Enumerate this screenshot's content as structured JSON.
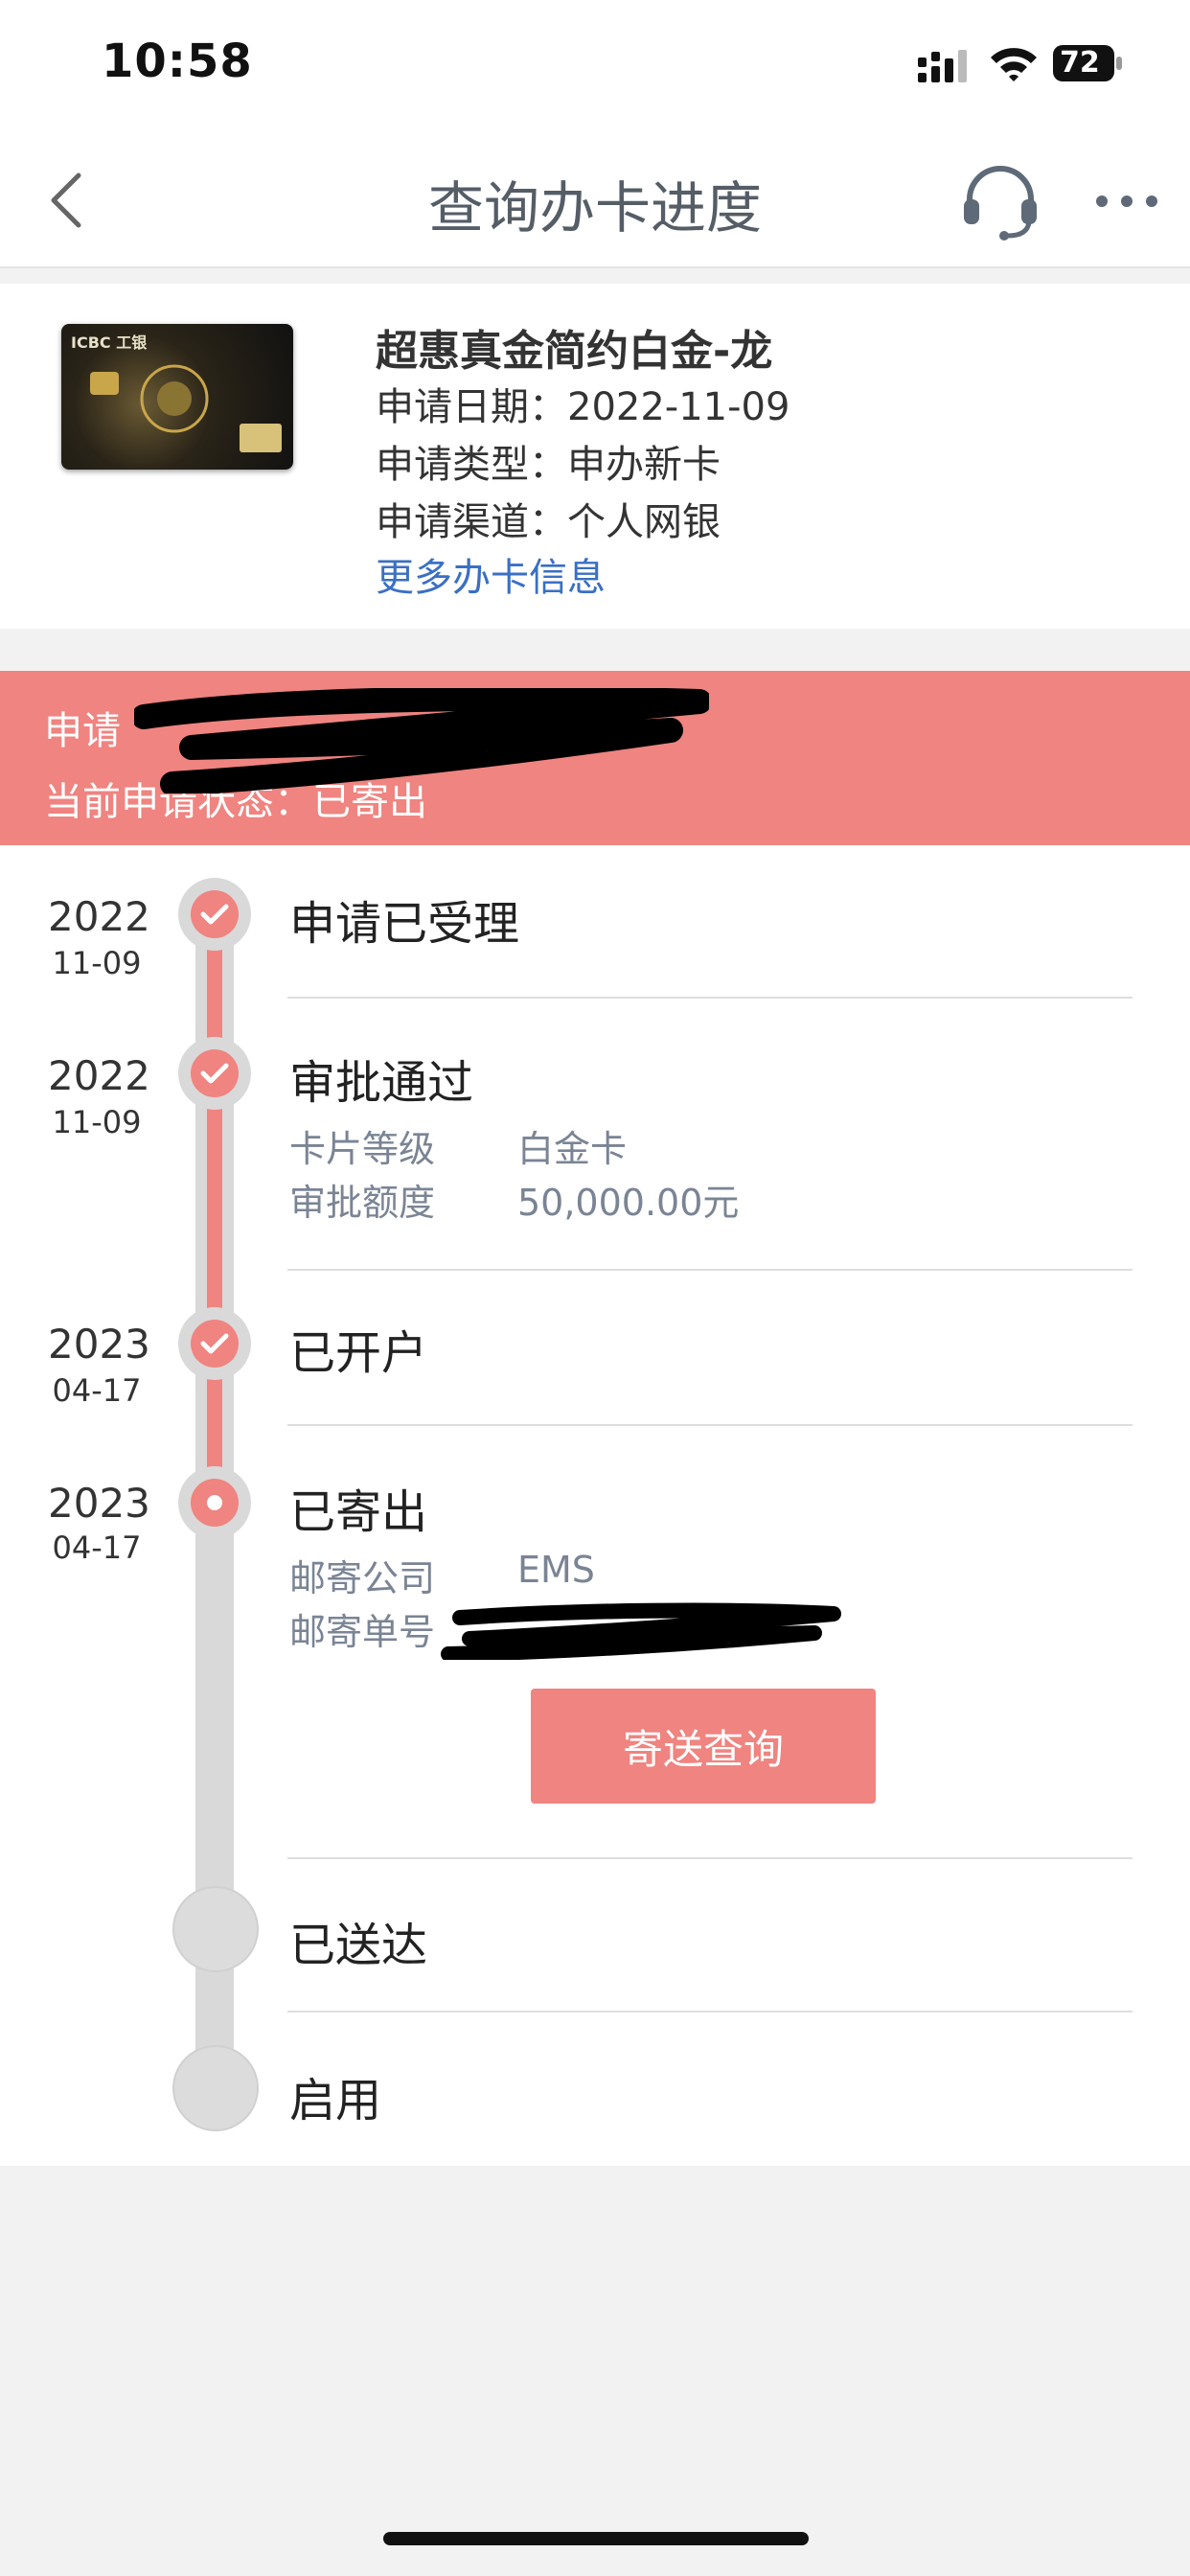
{
  "status_bar": {
    "time": "10:58",
    "battery": "72"
  },
  "nav": {
    "title": "查询办卡进度"
  },
  "card": {
    "name": "超惠真金简约白金-龙",
    "apply_date": "申请日期：2022-11-09",
    "apply_type": "申请类型：申办新卡",
    "apply_channel": "申请渠道：个人网银",
    "more_info": "更多办卡信息",
    "card_logo": "ICBC 工银"
  },
  "banner": {
    "line1": "申请",
    "line2": "当前申请状态：已寄出"
  },
  "timeline": {
    "steps": [
      {
        "year": "2022",
        "md": "11-09",
        "title": "申请已受理"
      },
      {
        "year": "2022",
        "md": "11-09",
        "title": "审批通过",
        "details": [
          {
            "label": "卡片等级",
            "value": "白金卡"
          },
          {
            "label": "审批额度",
            "value": "50,000.00元"
          }
        ]
      },
      {
        "year": "2023",
        "md": "04-17",
        "title": "已开户"
      },
      {
        "year": "2023",
        "md": "04-17",
        "title": "已寄出",
        "details": [
          {
            "label": "邮寄公司",
            "value": "EMS"
          },
          {
            "label": "邮寄单号",
            "value": ""
          }
        ]
      },
      {
        "title": "已送达"
      },
      {
        "title": "启用"
      }
    ],
    "track_button": "寄送查询"
  },
  "colors": {
    "accent": "#ef8480",
    "link": "#3a6fc4",
    "track": "#d9d9d9"
  }
}
